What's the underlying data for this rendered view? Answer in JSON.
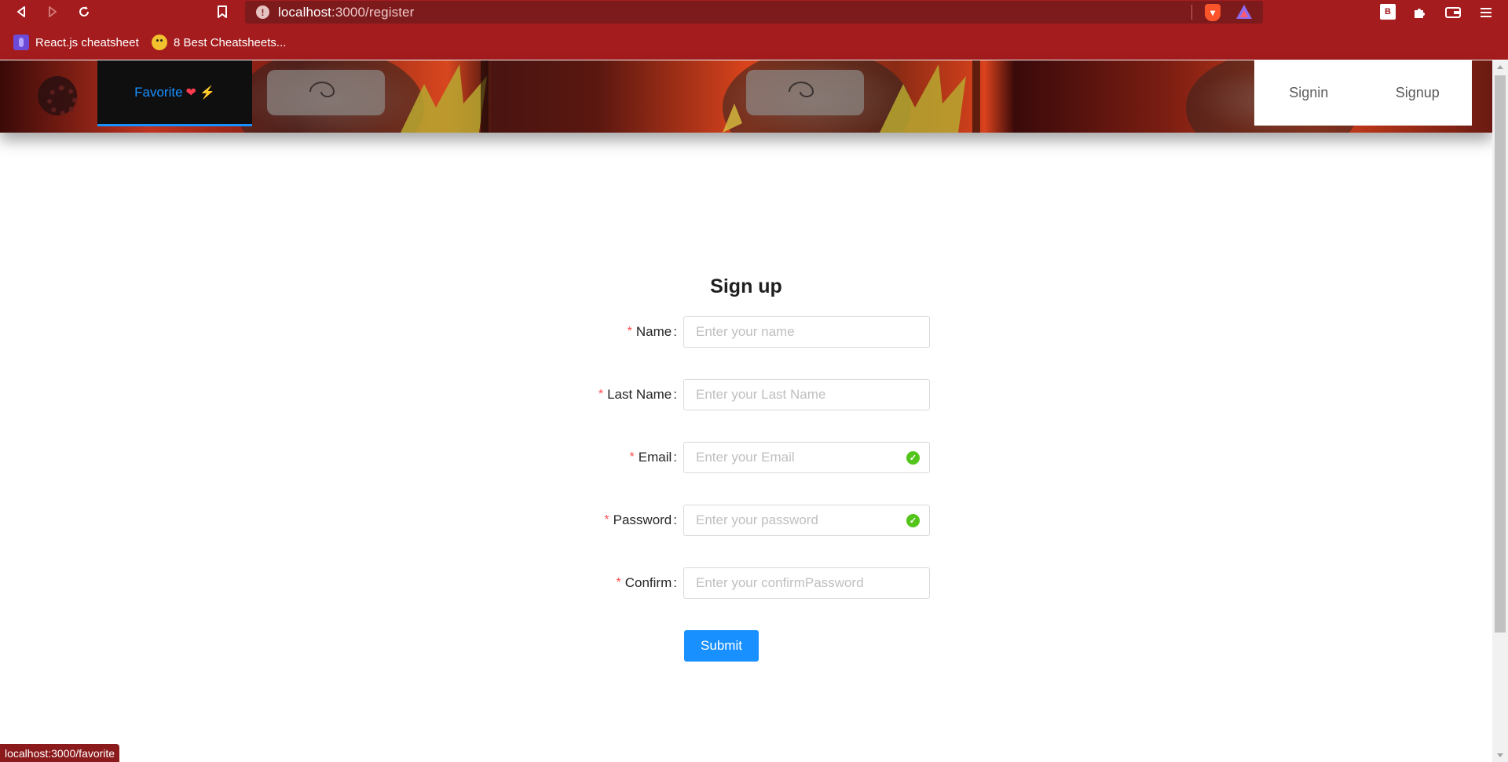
{
  "browser": {
    "url_host": "localhost",
    "url_path": ":3000/register",
    "bookmarks": [
      {
        "label": "React.js cheatsheet",
        "icon": "purple-bookmark-icon"
      },
      {
        "label": "8 Best Cheatsheets...",
        "icon": "chick-bookmark-icon"
      }
    ],
    "extension_badge": "B",
    "status_url": "localhost:3000/favorite"
  },
  "header": {
    "favorite_label": "Favorite",
    "signin_label": "Signin",
    "signup_label": "Signup"
  },
  "form": {
    "title": "Sign up",
    "fields": [
      {
        "label": "Name",
        "placeholder": "Enter your name",
        "valid": false
      },
      {
        "label": "Last Name",
        "placeholder": "Enter your Last Name",
        "valid": false
      },
      {
        "label": "Email",
        "placeholder": "Enter your Email",
        "valid": true
      },
      {
        "label": "Password",
        "placeholder": "Enter your password",
        "valid": true
      },
      {
        "label": "Confirm",
        "placeholder": "Enter your confirmPassword",
        "valid": false
      }
    ],
    "submit_label": "Submit"
  },
  "colors": {
    "chrome": "#a51c1e",
    "accent": "#1890ff",
    "required": "#ff4d4f",
    "success": "#52c41a"
  }
}
